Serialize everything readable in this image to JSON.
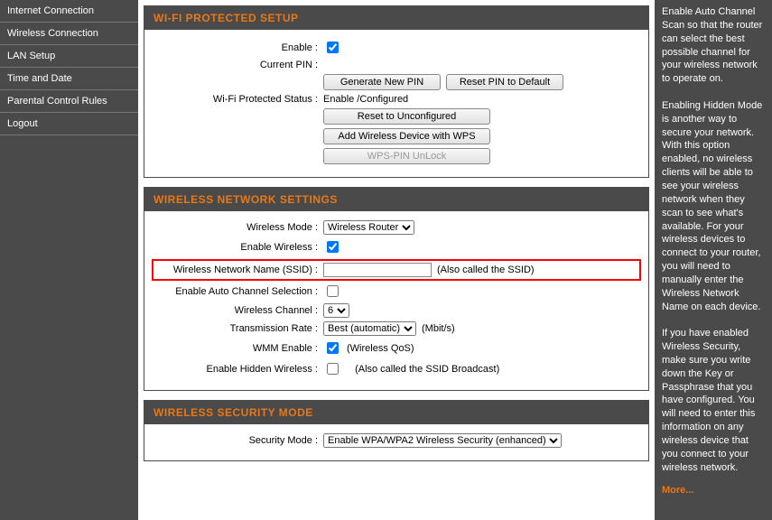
{
  "sidebar": {
    "items": [
      {
        "label": "Internet Connection"
      },
      {
        "label": "Wireless Connection"
      },
      {
        "label": "LAN Setup"
      },
      {
        "label": "Time and Date"
      },
      {
        "label": "Parental Control Rules"
      },
      {
        "label": "Logout"
      }
    ]
  },
  "panels": {
    "wps": {
      "title": "WI-FI PROTECTED SETUP",
      "enable_label": "Enable :",
      "enable_checked": true,
      "current_pin_label": "Current PIN :",
      "btn_generate": "Generate New PIN",
      "btn_reset_default": "Reset PIN to Default",
      "status_label": "Wi-Fi Protected Status :",
      "status_value": "Enable /Configured",
      "btn_reset_unconfig": "Reset to Unconfigured",
      "btn_add_device": "Add Wireless Device with WPS",
      "btn_unlock": "WPS-PIN UnLock"
    },
    "wireless": {
      "title": "WIRELESS NETWORK SETTINGS",
      "mode_label": "Wireless Mode :",
      "mode_value": "Wireless Router",
      "enable_wireless_label": "Enable Wireless :",
      "enable_wireless_checked": true,
      "ssid_label": "Wireless Network Name (SSID) :",
      "ssid_value": "",
      "ssid_note": "(Also called the SSID)",
      "auto_channel_label": "Enable Auto Channel Selection :",
      "auto_channel_checked": false,
      "channel_label": "Wireless Channel :",
      "channel_value": "6",
      "rate_label": "Transmission Rate :",
      "rate_value": "Best (automatic)",
      "rate_unit": "(Mbit/s)",
      "wmm_label": "WMM Enable :",
      "wmm_checked": true,
      "wmm_note": "(Wireless QoS)",
      "hidden_label": "Enable Hidden Wireless :",
      "hidden_checked": false,
      "hidden_note": "(Also called the SSID Broadcast)"
    },
    "security": {
      "title": "WIRELESS SECURITY MODE",
      "mode_label": "Security Mode :",
      "mode_value": "Enable WPA/WPA2 Wireless Security (enhanced)"
    }
  },
  "help": {
    "p1": "Enable Auto Channel Scan so that the router can select the best possible channel for your wireless network to operate on.",
    "p2": "Enabling Hidden Mode is another way to secure your network. With this option enabled, no wireless clients will be able to see your wireless network when they scan to see what's available. For your wireless devices to connect to your router, you will need to manually enter the Wireless Network Name on each device.",
    "p3": "If you have enabled Wireless Security, make sure you write down the Key or Passphrase that you have configured. You will need to enter this information on any wireless device that you connect to your wireless network.",
    "more": "More..."
  }
}
